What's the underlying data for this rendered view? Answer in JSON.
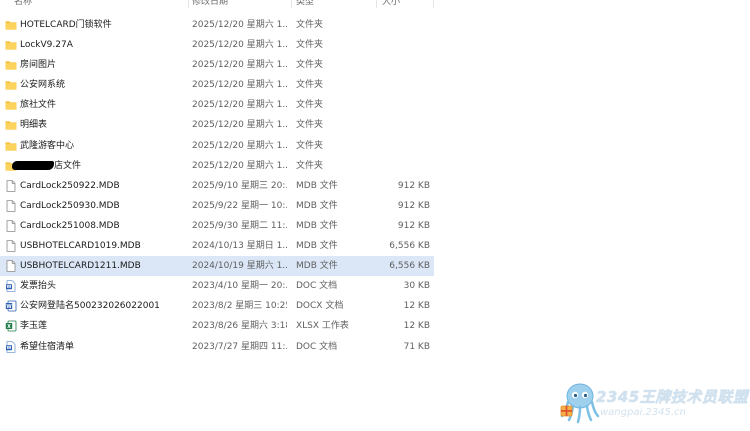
{
  "columns": {
    "name": "名称",
    "date": "修改日期",
    "type": "类型",
    "size": "大小"
  },
  "files": [
    {
      "icon": "folder-icon",
      "name": "HOTELCARD门锁软件",
      "date": "2025/12/20 星期六 1...",
      "type": "文件夹",
      "size": ""
    },
    {
      "icon": "folder-icon",
      "name": "LockV9.27A",
      "date": "2025/12/20 星期六 1...",
      "type": "文件夹",
      "size": ""
    },
    {
      "icon": "folder-icon",
      "name": "房间图片",
      "date": "2025/12/20 星期六 1...",
      "type": "文件夹",
      "size": ""
    },
    {
      "icon": "folder-icon",
      "name": "公安网系统",
      "date": "2025/12/20 星期六 1...",
      "type": "文件夹",
      "size": ""
    },
    {
      "icon": "folder-icon",
      "name": "旅社文件",
      "date": "2025/12/20 星期六 1...",
      "type": "文件夹",
      "size": ""
    },
    {
      "icon": "folder-icon",
      "name": "明细表",
      "date": "2025/12/20 星期六 1...",
      "type": "文件夹",
      "size": ""
    },
    {
      "icon": "folder-icon",
      "name": "武隆游客中心",
      "date": "2025/12/20 星期六 1...",
      "type": "文件夹",
      "size": ""
    },
    {
      "icon": "folder-icon",
      "name": "店文件",
      "date": "2025/12/20 星期六 1...",
      "type": "文件夹",
      "size": "",
      "redacted": true
    },
    {
      "icon": "file-icon",
      "name": "CardLock250922.MDB",
      "date": "2025/9/10 星期三 20:...",
      "type": "MDB 文件",
      "size": "912 KB"
    },
    {
      "icon": "file-icon",
      "name": "CardLock250930.MDB",
      "date": "2025/9/22 星期一 10:...",
      "type": "MDB 文件",
      "size": "912 KB"
    },
    {
      "icon": "file-icon",
      "name": "CardLock251008.MDB",
      "date": "2025/9/30 星期二 11:...",
      "type": "MDB 文件",
      "size": "912 KB"
    },
    {
      "icon": "file-icon",
      "name": "USBHOTELCARD1019.MDB",
      "date": "2024/10/13 星期日 1...",
      "type": "MDB 文件",
      "size": "6,556 KB"
    },
    {
      "icon": "file-icon",
      "name": "USBHOTELCARD1211.MDB",
      "date": "2024/10/19 星期六 1...",
      "type": "MDB 文件",
      "size": "6,556 KB",
      "selected": true
    },
    {
      "icon": "word-doc-icon",
      "name": "发票抬头",
      "date": "2023/4/10 星期一 20:...",
      "type": "DOC 文档",
      "size": "30 KB"
    },
    {
      "icon": "word-docx-icon",
      "name": "公安网登陆名500232026022001",
      "date": "2023/8/2 星期三 10:25",
      "type": "DOCX 文档",
      "size": "12 KB"
    },
    {
      "icon": "excel-icon",
      "name": "李玉莲",
      "date": "2023/8/26 星期六 3:18",
      "type": "XLSX 工作表",
      "size": "12 KB"
    },
    {
      "icon": "word-doc-icon",
      "name": "希望住宿清单",
      "date": "2023/7/27 星期四 11:...",
      "type": "DOC 文档",
      "size": "71 KB"
    }
  ],
  "watermark": {
    "title": "2345王牌技术员联盟",
    "url": "wangpai.2345.cn"
  }
}
